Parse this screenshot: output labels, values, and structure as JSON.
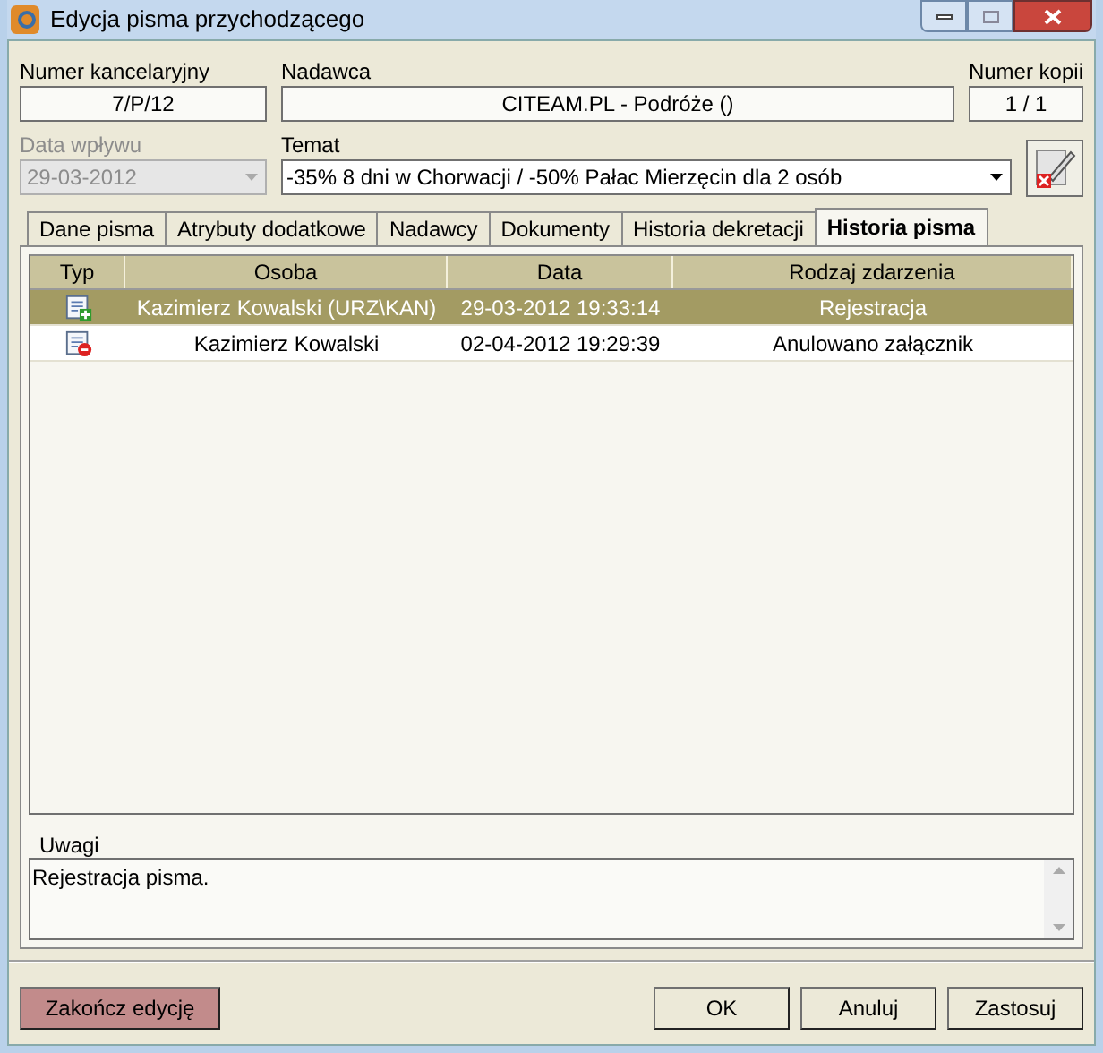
{
  "window": {
    "title": "Edycja pisma przychodzącego"
  },
  "fields": {
    "numer_kancelaryjny": {
      "label": "Numer kancelaryjny",
      "value": "7/P/12"
    },
    "nadawca": {
      "label": "Nadawca",
      "value": "CITEAM.PL - Podróże ()"
    },
    "numer_kopii": {
      "label": "Numer kopii",
      "value": "1 / 1"
    },
    "data_wplywu": {
      "label": "Data wpływu",
      "value": "29-03-2012",
      "disabled": true
    },
    "temat": {
      "label": "Temat",
      "value": "-35% 8 dni w Chorwacji / -50% Pałac Mierzęcin dla 2 osób",
      "disabled": false
    }
  },
  "tabs": [
    {
      "label": "Dane pisma",
      "selected": false
    },
    {
      "label": "Atrybuty dodatkowe",
      "selected": false
    },
    {
      "label": "Nadawcy",
      "selected": false
    },
    {
      "label": "Dokumenty",
      "selected": false
    },
    {
      "label": "Historia dekretacji",
      "selected": false
    },
    {
      "label": "Historia pisma",
      "selected": true
    }
  ],
  "table": {
    "columns": [
      "Typ",
      "Osoba",
      "Data",
      "Rodzaj zdarzenia"
    ],
    "rows": [
      {
        "kind": "added",
        "osoba": "Kazimierz Kowalski (URZ\\KAN)",
        "data": "29-03-2012 19:33:14",
        "rodzaj": "Rejestracja",
        "selected": true
      },
      {
        "kind": "removed",
        "osoba": "Kazimierz Kowalski",
        "data": "02-04-2012 19:29:39",
        "rodzaj": "Anulowano załącznik",
        "selected": false
      }
    ]
  },
  "uwagi": {
    "label": "Uwagi",
    "value": "Rejestracja pisma."
  },
  "buttons": {
    "finish": "Zakończ edycję",
    "ok": "OK",
    "cancel": "Anuluj",
    "apply": "Zastosuj"
  }
}
